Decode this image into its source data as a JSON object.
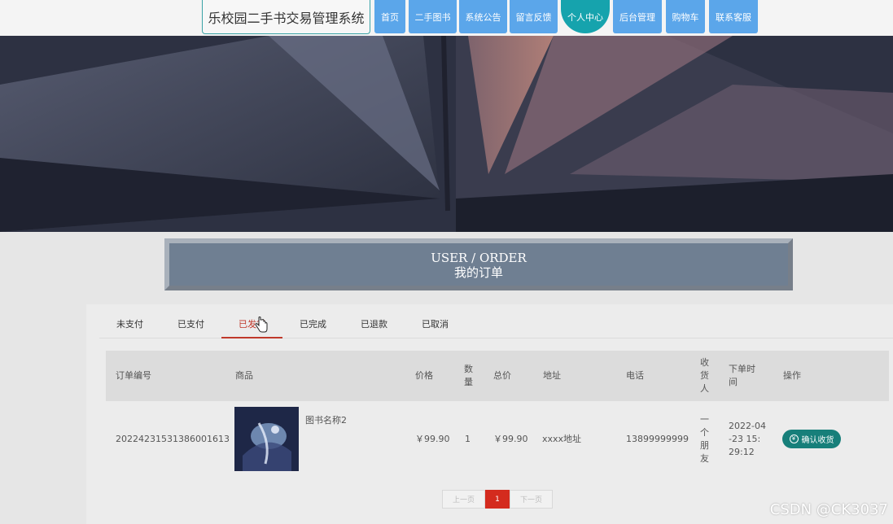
{
  "site_title": "乐校园二手书交易管理系统",
  "nav": [
    {
      "label": "首页"
    },
    {
      "label": "二手图书"
    },
    {
      "label": "系统公告"
    },
    {
      "label": "留言反馈"
    },
    {
      "label": "个人中心",
      "active": true
    },
    {
      "label": "后台管理"
    },
    {
      "label": "购物车"
    },
    {
      "label": "联系客服"
    }
  ],
  "section": {
    "title_en": "USER / ORDER",
    "title_zh": "我的订单"
  },
  "tabs": [
    {
      "label": "未支付"
    },
    {
      "label": "已支付"
    },
    {
      "label": "已发货",
      "active": true
    },
    {
      "label": "已完成"
    },
    {
      "label": "已退款"
    },
    {
      "label": "已取消"
    }
  ],
  "table": {
    "headers": {
      "order_no": "订单编号",
      "product": "商品",
      "price": "价格",
      "qty": "数量",
      "total": "总价",
      "address": "地址",
      "phone": "电话",
      "receiver": "收货人",
      "order_time": "下单时间",
      "action": "操作"
    },
    "rows": [
      {
        "order_no": "20224231531386001613",
        "product_name": "图书名称2",
        "price": "￥99.90",
        "qty": "1",
        "total": "￥99.90",
        "address": "xxxx地址",
        "phone": "13899999999",
        "receiver": "一个朋友",
        "order_time": "2022-04-23 15:29:12",
        "action_label": "确认收货"
      }
    ]
  },
  "pagination": {
    "prev": "上一页",
    "current": "1",
    "next": "下一页"
  },
  "watermark": "CSDN @CK3037",
  "colors": {
    "nav_blue": "#5ba6ea",
    "nav_active": "#16a3ad",
    "tab_active": "#c0392b",
    "action_green": "#177f7a",
    "page_current": "#d42b1e"
  }
}
